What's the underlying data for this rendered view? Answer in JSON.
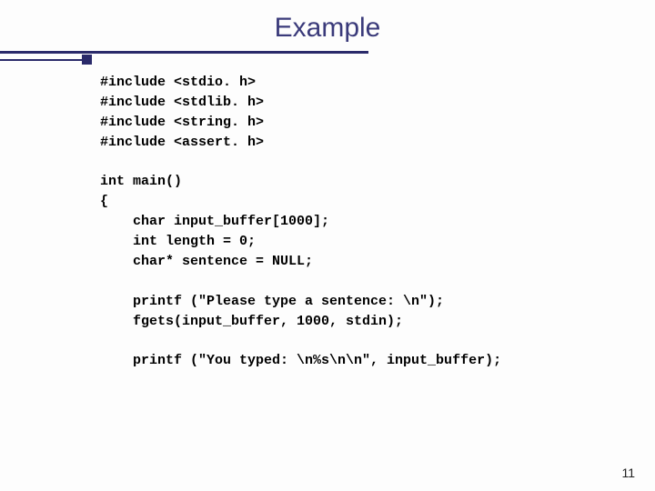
{
  "title": "Example",
  "code": {
    "includes": [
      "#include <stdio. h>",
      "#include <stdlib. h>",
      "#include <string. h>",
      "#include <assert. h>"
    ],
    "main_open": "int main()",
    "brace_open": "{",
    "decl1": "    char input_buffer[1000];",
    "decl2": "    int length = 0;",
    "decl3": "    char* sentence = NULL;",
    "stmt1": "    printf (\"Please type a sentence: \\n\");",
    "stmt2": "    fgets(input_buffer, 1000, stdin);",
    "stmt3": "    printf (\"You typed: \\n%s\\n\\n\", input_buffer);"
  },
  "page_number": "11"
}
